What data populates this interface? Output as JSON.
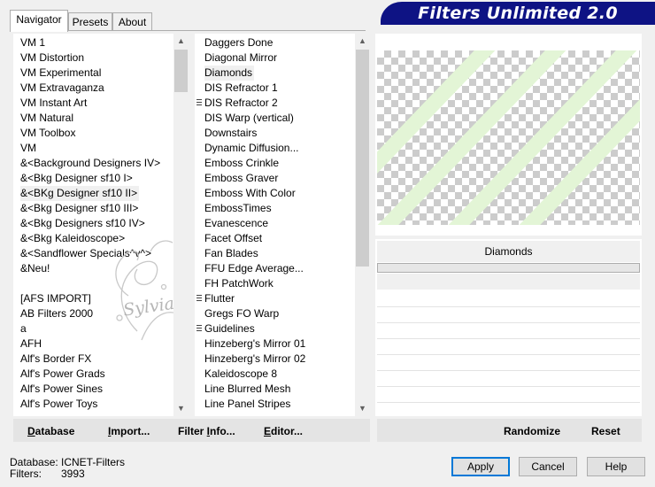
{
  "tabs": [
    "Navigator",
    "Presets",
    "About"
  ],
  "banner_title": "Filters Unlimited 2.0",
  "categories": [
    "VM 1",
    "VM Distortion",
    "VM Experimental",
    "VM Extravaganza",
    "VM Instant Art",
    "VM Natural",
    "VM Toolbox",
    "VM",
    "&<Background Designers IV>",
    "&<Bkg Designer sf10 I>",
    "&<BKg Designer sf10 II>",
    "&<Bkg Designer sf10 III>",
    "&<Bkg Designers sf10 IV>",
    "&<Bkg Kaleidoscope>",
    "&<Sandflower Specials^v^>",
    "&Neu!",
    "",
    "[AFS IMPORT]",
    "AB Filters 2000",
    "a",
    "AFH",
    "Alf's Border FX",
    "Alf's Power Grads",
    "Alf's Power Sines",
    "Alf's Power Toys"
  ],
  "categories_selected": "&<BKg Designer sf10 II>",
  "filters": [
    "Daggers Done",
    "Diagonal Mirror",
    "Diamonds",
    "DIS Refractor 1",
    "DIS Refractor 2",
    "DIS Warp (vertical)",
    "Downstairs",
    "Dynamic Diffusion...",
    "Emboss Crinkle",
    "Emboss Graver",
    "Emboss With Color",
    "EmbossTimes",
    "Evanescence",
    "Facet Offset",
    "Fan Blades",
    "FFU Edge Average...",
    "FH PatchWork",
    "Flutter",
    "Gregs FO Warp",
    "Guidelines",
    "Hinzeberg's Mirror 01",
    "Hinzeberg's Mirror 02",
    "Kaleidoscope 8",
    "Line Blurred Mesh",
    "Line Panel Stripes"
  ],
  "filters_selected": "Diamonds",
  "filters_marked": [
    "DIS Refractor 2",
    "Flutter",
    "Guidelines"
  ],
  "watermark_text": "Sylviane",
  "preview": {
    "label": "Diamonds",
    "stripe_color": "#e3f5d6"
  },
  "buttons": {
    "database": "Database",
    "import": "Import...",
    "filter_info": "Filter Info...",
    "editor": "Editor...",
    "randomize": "Randomize",
    "reset": "Reset",
    "apply": "Apply",
    "cancel": "Cancel",
    "help": "Help"
  },
  "status": {
    "database_label": "Database:",
    "database_value": "ICNET-Filters",
    "filters_label": "Filters:",
    "filters_value": "3993"
  },
  "colors": {
    "banner": "#0e1384",
    "selection": "#f0f0f0"
  }
}
